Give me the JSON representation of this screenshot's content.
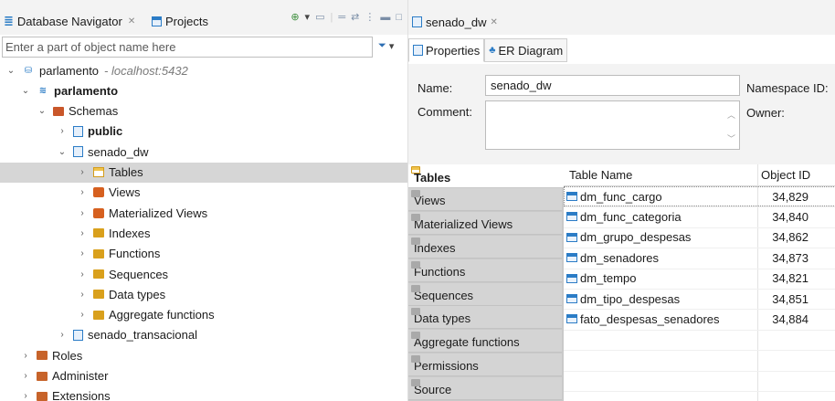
{
  "left": {
    "tabs": [
      {
        "label": "Database Navigator",
        "close": "✕"
      },
      {
        "label": "Projects"
      }
    ],
    "filter": {
      "placeholder": "Enter a part of object name here"
    },
    "tree": [
      {
        "label": "parlamento",
        "host": "- localhost:5432",
        "icon": "connection-icon",
        "chev": "⌄"
      },
      {
        "label": "parlamento",
        "icon": "database-icon",
        "chev": "⌄",
        "bold": true
      },
      {
        "label": "Schemas",
        "icon": "schemas-icon",
        "chev": "⌄"
      },
      {
        "label": "public",
        "icon": "schema-icon",
        "chev": "›",
        "bold": true
      },
      {
        "label": "senado_dw",
        "icon": "schema-icon",
        "chev": "⌄"
      },
      {
        "label": "Tables",
        "icon": "tables-folder-icon",
        "chev": "›",
        "selected": true
      },
      {
        "label": "Views",
        "icon": "views-icon",
        "chev": "›"
      },
      {
        "label": "Materialized Views",
        "icon": "materialized-views-icon",
        "chev": "›"
      },
      {
        "label": "Indexes",
        "icon": "folder-icon",
        "chev": "›"
      },
      {
        "label": "Functions",
        "icon": "folder-icon",
        "chev": "›"
      },
      {
        "label": "Sequences",
        "icon": "folder-icon",
        "chev": "›"
      },
      {
        "label": "Data types",
        "icon": "folder-icon",
        "chev": "›"
      },
      {
        "label": "Aggregate functions",
        "icon": "folder-icon",
        "chev": "›"
      },
      {
        "label": "senado_transacional",
        "icon": "schema-icon",
        "chev": "›"
      },
      {
        "label": "Roles",
        "icon": "roles-icon",
        "chev": "›"
      },
      {
        "label": "Administer",
        "icon": "administer-icon",
        "chev": "›"
      },
      {
        "label": "Extensions",
        "icon": "extensions-icon",
        "chev": "›"
      }
    ]
  },
  "editor": {
    "tab": {
      "label": "senado_dw",
      "close": "✕"
    },
    "subtabs": [
      "Properties",
      "ER Diagram"
    ],
    "form": {
      "name_label": "Name:",
      "name_value": "senado_dw",
      "comment_label": "Comment:",
      "namespace_label": "Namespace ID:",
      "owner_label": "Owner:"
    },
    "side_tabs": [
      "Tables",
      "Views",
      "Materialized Views",
      "Indexes",
      "Functions",
      "Sequences",
      "Data types",
      "Aggregate functions",
      "Permissions",
      "Source"
    ],
    "table": {
      "columns": [
        "Table Name",
        "Object ID"
      ],
      "rows": [
        {
          "name": "dm_func_cargo",
          "id": "34,829"
        },
        {
          "name": "dm_func_categoria",
          "id": "34,840"
        },
        {
          "name": "dm_grupo_despesas",
          "id": "34,862"
        },
        {
          "name": "dm_senadores",
          "id": "34,873"
        },
        {
          "name": "dm_tempo",
          "id": "34,821"
        },
        {
          "name": "dm_tipo_despesas",
          "id": "34,851"
        },
        {
          "name": "fato_despesas_senadores",
          "id": "34,884"
        }
      ]
    }
  }
}
